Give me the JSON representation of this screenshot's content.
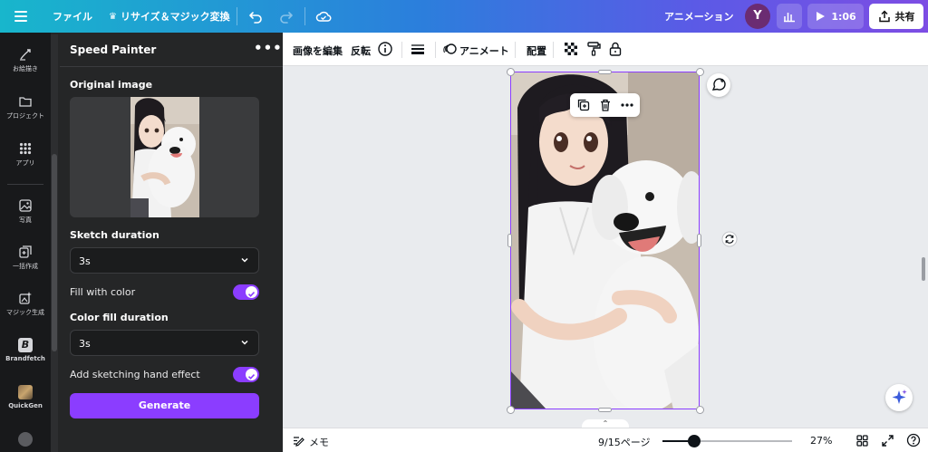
{
  "topbar": {
    "file_label": "ファイル",
    "resize_label": "リサイズ＆マジック変換",
    "animation_label": "アニメーション",
    "avatar_initial": "Y",
    "play_time": "1:06",
    "share_label": "共有"
  },
  "rail": {
    "items": [
      {
        "label": "お絵描き",
        "icon": "draw-icon"
      },
      {
        "label": "プロジェクト",
        "icon": "folder-icon"
      },
      {
        "label": "アプリ",
        "icon": "apps-grid-icon"
      },
      {
        "label": "写真",
        "icon": "photo-icon"
      },
      {
        "label": "一括作成",
        "icon": "bulk-create-icon"
      },
      {
        "label": "マジック生成",
        "icon": "magic-generate-icon"
      },
      {
        "label": "Brandfetch",
        "icon": "brandfetch-icon"
      },
      {
        "label": "QuickGen",
        "icon": "quickgen-icon"
      }
    ]
  },
  "panel": {
    "title": "Speed Painter",
    "original_image_label": "Original image",
    "sketch_duration_label": "Sketch duration",
    "sketch_duration_value": "3s",
    "fill_color_label": "Fill with color",
    "fill_color_on": true,
    "color_fill_duration_label": "Color fill duration",
    "color_fill_duration_value": "3s",
    "hand_effect_label": "Add sketching hand effect",
    "hand_effect_on": true,
    "generate_label": "Generate"
  },
  "editor_toolbar": {
    "edit_image_label": "画像を編集",
    "flip_label": "反転",
    "animate_label": "アニメート",
    "position_label": "配置"
  },
  "footer": {
    "notes_label": "メモ",
    "page_indicator": "9/15ページ",
    "zoom_label": "27%",
    "zoom_fraction": 0.27
  },
  "colors": {
    "accent": "#8b3dff",
    "topbar_start": "#18b6cc",
    "topbar_end": "#7d4de4",
    "panel_bg": "#252627",
    "rail_bg": "#18191b"
  }
}
